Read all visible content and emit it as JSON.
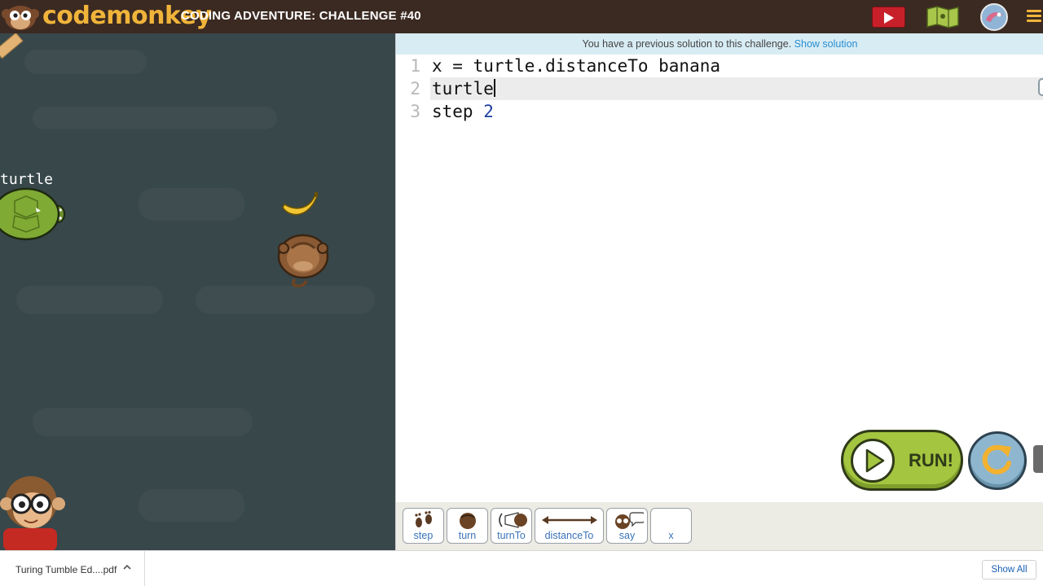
{
  "header": {
    "logo_text": "codemonkey",
    "challenge_title": "CODING ADVENTURE: CHALLENGE #40",
    "icons": [
      "youtube-play-icon",
      "map-icon",
      "avatar-icon",
      "menu-icon"
    ]
  },
  "game": {
    "turtle_label": "turtle"
  },
  "editor": {
    "notice_text": "You have a previous solution to this challenge. ",
    "notice_link": "Show solution",
    "lines": [
      {
        "number": "1",
        "text": "x = turtle.distanceTo banana"
      },
      {
        "number": "2",
        "text": "turtle"
      },
      {
        "number": "3",
        "text_before": "step ",
        "number_literal": "2"
      }
    ],
    "run_label": "RUN!"
  },
  "palette": {
    "commands": [
      "step",
      "turn",
      "turnTo",
      "distanceTo",
      "say",
      "x"
    ]
  },
  "downloads": {
    "file_name": "Turing Tumble Ed....pdf",
    "show_all": "Show All"
  },
  "colors": {
    "topbar": "#3b2a22",
    "logo": "#f0b43a",
    "game_bg": "#38474a",
    "run_green": "#a4c540",
    "link_blue": "#2a8fd1"
  }
}
